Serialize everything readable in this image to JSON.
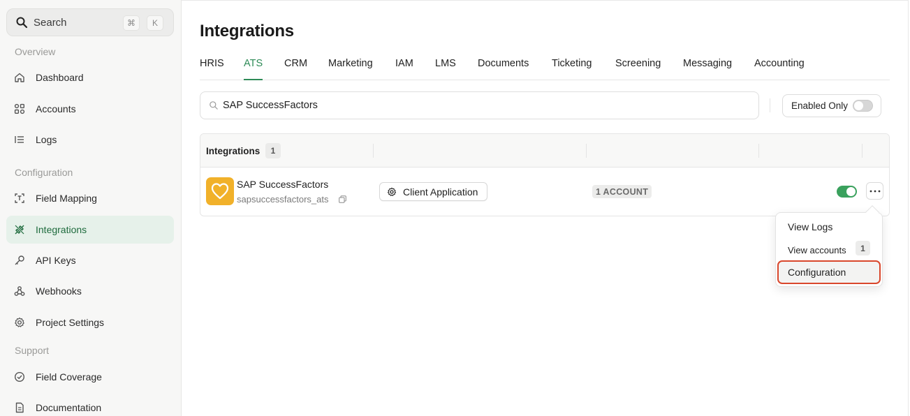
{
  "search": {
    "label": "Search",
    "shortcut_mod": "⌘",
    "shortcut_key": "K"
  },
  "sidebar": {
    "sections": [
      {
        "label": "Overview"
      },
      {
        "label": "Configuration"
      },
      {
        "label": "Support"
      }
    ],
    "items": [
      {
        "label": "Dashboard",
        "icon": "home-icon"
      },
      {
        "label": "Accounts",
        "icon": "grid-icon"
      },
      {
        "label": "Logs",
        "icon": "list-icon"
      },
      {
        "label": "Field Mapping",
        "icon": "mapping-icon"
      },
      {
        "label": "Integrations",
        "icon": "plug-icon",
        "active": true
      },
      {
        "label": "API Keys",
        "icon": "key-icon"
      },
      {
        "label": "Webhooks",
        "icon": "webhook-icon"
      },
      {
        "label": "Project Settings",
        "icon": "gear-icon"
      },
      {
        "label": "Field Coverage",
        "icon": "check-circle-icon"
      },
      {
        "label": "Documentation",
        "icon": "document-icon"
      }
    ]
  },
  "main": {
    "title": "Integrations",
    "tabs": [
      "HRIS",
      "ATS",
      "CRM",
      "Marketing",
      "IAM",
      "LMS",
      "Documents",
      "Ticketing",
      "Screening",
      "Messaging",
      "Accounting"
    ],
    "active_tab": "ATS",
    "filter_value": "SAP SuccessFactors",
    "enabled_only_label": "Enabled Only",
    "enabled_only": false,
    "table": {
      "header_label": "Integrations",
      "count": "1",
      "rows": [
        {
          "name": "SAP SuccessFactors",
          "slug": "sapsuccessfactors_ats",
          "app_button": "Client Application",
          "accounts_badge": "1 ACCOUNT",
          "enabled": true
        }
      ]
    },
    "menu": {
      "items": [
        {
          "label": "View Logs"
        },
        {
          "label": "View accounts",
          "badge": "1"
        },
        {
          "label": "Configuration",
          "highlighted": true
        }
      ]
    }
  },
  "colors": {
    "accent": "#2e8b57",
    "active_nav_bg": "#e6f1ea",
    "toggle_on": "#3aa15d",
    "logo_bg": "#f1b12a",
    "highlight_outline": "#d9472c"
  }
}
